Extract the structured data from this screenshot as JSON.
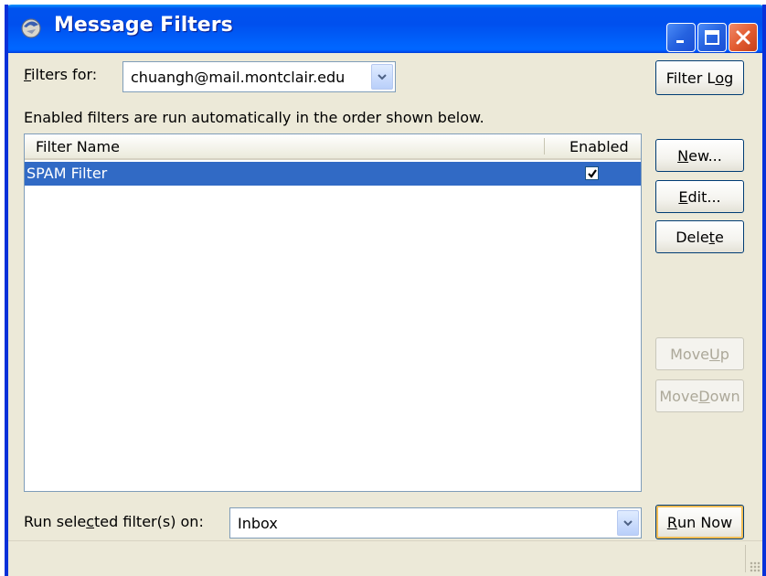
{
  "window": {
    "title": "Message Filters",
    "icon": "thunderbird-icon"
  },
  "titlebar_buttons": [
    "minimize-icon",
    "maximize-icon",
    "close-icon"
  ],
  "filters_for": {
    "label_pre": "",
    "label_accel": "F",
    "label_post": "ilters for:",
    "account": "chuangh@mail.montclair.edu"
  },
  "filter_log": {
    "pre": "Filter L",
    "accel": "o",
    "post": "g"
  },
  "description": "Enabled filters are run automatically in the order shown below.",
  "table": {
    "columns": [
      "Filter Name",
      "Enabled"
    ],
    "rows": [
      {
        "name": "SPAM Filter",
        "enabled": true,
        "selected": true
      }
    ]
  },
  "side_buttons": {
    "new": {
      "pre": "",
      "accel": "N",
      "post": "ew..."
    },
    "edit": {
      "pre": "",
      "accel": "E",
      "post": "dit..."
    },
    "delete": {
      "pre": "Dele",
      "accel": "t",
      "post": "e"
    },
    "move_up": {
      "pre": "Move ",
      "accel": "U",
      "post": "p",
      "disabled": true
    },
    "move_down": {
      "pre": "Move ",
      "accel": "D",
      "post": "own",
      "disabled": true
    }
  },
  "run_on": {
    "label_pre": "Run sele",
    "label_accel": "c",
    "label_post": "ted filter(s) on:",
    "folder": "Inbox"
  },
  "run_now": {
    "pre": "",
    "accel": "R",
    "post": "un Now"
  },
  "colors": {
    "titlebar": "#0055e5",
    "selection": "#316ac5",
    "window_bg": "#ece9d8"
  }
}
